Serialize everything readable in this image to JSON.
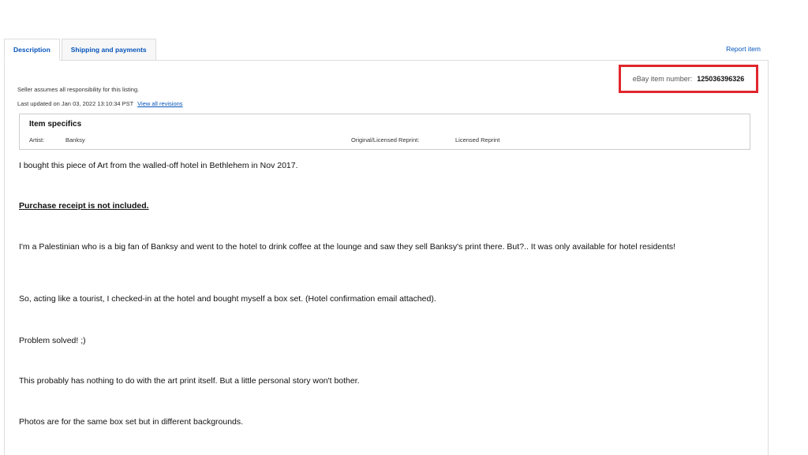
{
  "tabs": [
    {
      "label": "Description",
      "active": true
    },
    {
      "label": "Shipping and payments",
      "active": false
    }
  ],
  "report_item": "Report item",
  "item_number": {
    "label": "eBay item number:",
    "value": "125036396326",
    "highlight_color": "#e0262d"
  },
  "seller_note": "Seller assumes all responsibility for this listing.",
  "last_updated": {
    "prefix": "Last updated on",
    "date": "Jan 03, 2022 13:10:34 PST",
    "revisions_link": "View all revisions"
  },
  "item_specifics": {
    "title": "Item specifics",
    "fields": [
      {
        "label": "Artist:",
        "value": "Banksy"
      },
      {
        "label": "Original/Licensed Reprint:",
        "value": "Licensed Reprint"
      }
    ]
  },
  "description": [
    "I bought this piece of Art from the walled-off hotel in Bethlehem in Nov 2017.",
    "Purchase receipt is not included.",
    "I'm a Palestinian who is a big fan of Banksy and went to the hotel to drink coffee at the lounge and saw they sell Banksy's print there. But?.. It was only available for hotel residents!",
    "So, acting like a tourist, I checked-in at the hotel and bought myself a box set. (Hotel confirmation email attached).",
    "Problem solved! ;)",
    "This probably has nothing to do with the art print itself. But a little personal story won't bother.",
    "Photos are for the same box set but in different backgrounds."
  ],
  "colors": {
    "link": "#0654ba",
    "text": "#111820",
    "border": "#dddddd"
  }
}
